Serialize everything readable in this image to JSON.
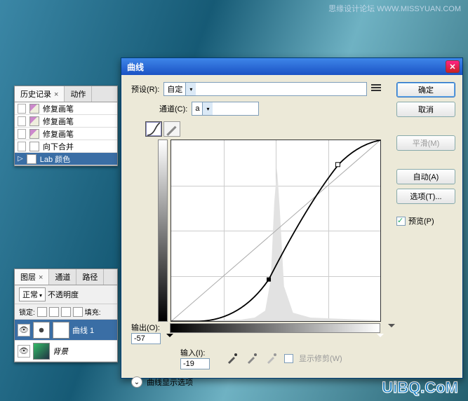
{
  "watermark": {
    "top": "思缘设计论坛  WWW.MISSYUAN.COM",
    "bottom": "UiBQ.CoM"
  },
  "history": {
    "tabs": [
      "历史记录",
      "动作"
    ],
    "items": [
      "修复画笔",
      "修复画笔",
      "修复画笔",
      "向下合并",
      "Lab 颜色"
    ]
  },
  "layers": {
    "tabs": [
      "图层",
      "通道",
      "路径"
    ],
    "mode": "正常",
    "opacity_label": "不透明度",
    "lock_label": "锁定:",
    "fill_label": "填充:",
    "rows": [
      "曲线 1",
      "背景"
    ]
  },
  "curves": {
    "title": "曲线",
    "preset_label": "预设(R):",
    "preset_value": "自定",
    "channel_label": "通道(C):",
    "channel_value": "a",
    "output_label": "输出(O):",
    "output_value": "-57",
    "input_label": "输入(I):",
    "input_value": "-19",
    "show_clip": "显示修剪(W)",
    "display_options": "曲线显示选项",
    "ok": "确定",
    "cancel": "取消",
    "smooth": "平滑(M)",
    "auto": "自动(A)",
    "options": "选项(T)...",
    "preview": "预览(P)"
  }
}
